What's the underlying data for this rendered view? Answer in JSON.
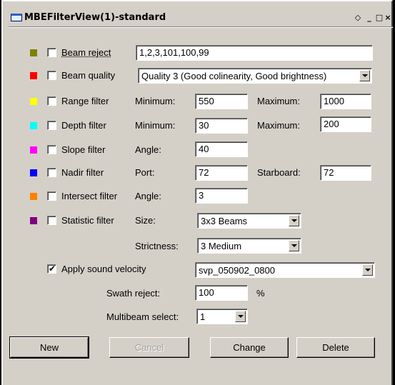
{
  "window": {
    "title": "MBEFilterView(1)-standard",
    "controls": {
      "restore": "◇",
      "minimize": "_",
      "maximize": "□",
      "close": "×"
    }
  },
  "filters": [
    {
      "label": "Beam reject",
      "color": "#808000",
      "checked": false
    },
    {
      "label": "Beam quality",
      "color": "#ff0000",
      "checked": false
    },
    {
      "label": "Range filter",
      "color": "#ffff00",
      "checked": false
    },
    {
      "label": "Depth filter",
      "color": "#00ffff",
      "checked": false
    },
    {
      "label": "Slope filter",
      "color": "#ff00ff",
      "checked": false
    },
    {
      "label": "Nadir filter",
      "color": "#0000ff",
      "checked": false
    },
    {
      "label": "Intersect filter",
      "color": "#ff8000",
      "checked": false
    },
    {
      "label": "Statistic filter",
      "color": "#800080",
      "checked": false
    }
  ],
  "beam_reject": {
    "value": "1,2,3,101,100,99"
  },
  "beam_quality": {
    "value": "Quality 3  (Good colinearity, Good brightness)"
  },
  "range": {
    "min_label": "Minimum:",
    "min": "550",
    "max_label": "Maximum:",
    "max": "1000"
  },
  "depth": {
    "min_label": "Minimum:",
    "min": "30",
    "max_label": "Maximum:",
    "max": "200"
  },
  "slope": {
    "angle_label": "Angle:",
    "angle": "40"
  },
  "nadir": {
    "port_label": "Port:",
    "port": "72",
    "starboard_label": "Starboard:",
    "starboard": "72"
  },
  "intersect": {
    "angle_label": "Angle:",
    "angle": "3"
  },
  "statistic": {
    "size_label": "Size:",
    "size": "3x3 Beams",
    "strictness_label": "Strictness:",
    "strictness": "3 Medium"
  },
  "sound_velocity": {
    "label": "Apply sound velocity",
    "checked": true,
    "value": "svp_050902_0800"
  },
  "swath_reject": {
    "label": "Swath reject:",
    "value": "100",
    "unit": "%"
  },
  "multibeam_select": {
    "label": "Multibeam select:",
    "value": "1"
  },
  "buttons": {
    "new": "New",
    "cancel": "Cancel",
    "change": "Change",
    "delete": "Delete"
  }
}
